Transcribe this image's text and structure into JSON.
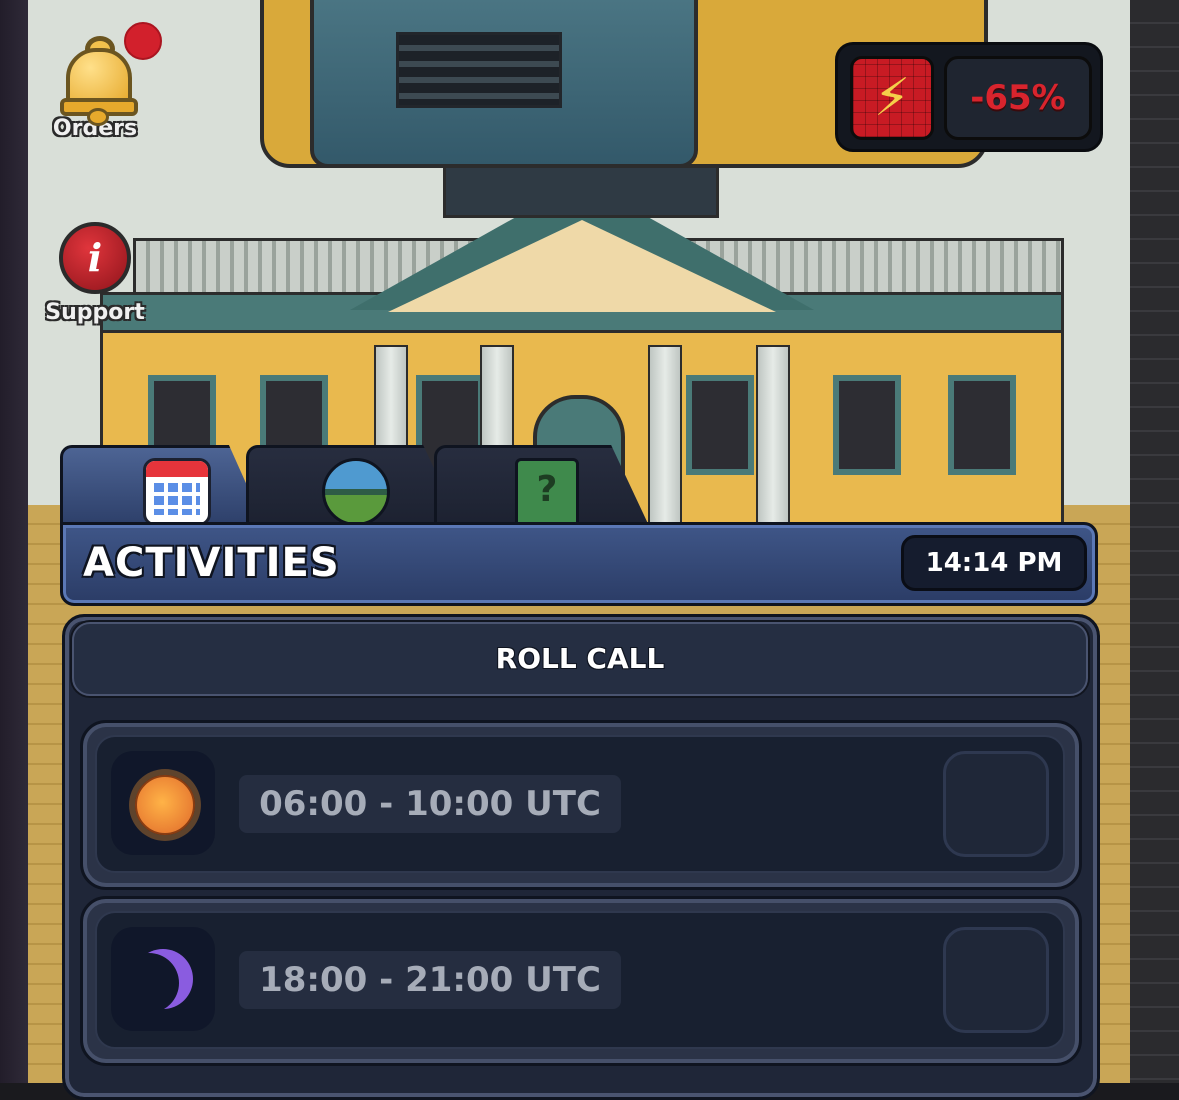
{
  "sidebar": {
    "orders_label": "Orders",
    "support_label": "Support"
  },
  "energy": {
    "value": "-65%",
    "icon": "lightning-bolt-icon"
  },
  "tabs": [
    {
      "icon": "calendar-icon",
      "active": true
    },
    {
      "icon": "prison-yard-icon",
      "active": false
    },
    {
      "icon": "help-book-icon",
      "active": false
    }
  ],
  "header": {
    "title": "ACTIVITIES",
    "time": "14:14 PM"
  },
  "section": {
    "title": "ROLL CALL"
  },
  "slots": [
    {
      "icon": "sun-icon",
      "time": "06:00 - 10:00 UTC"
    },
    {
      "icon": "moon-icon",
      "time": "18:00 - 21:00 UTC"
    }
  ],
  "colors": {
    "accent": "#3f5688",
    "panel": "#1f2638",
    "energy_red": "#d9242d"
  }
}
